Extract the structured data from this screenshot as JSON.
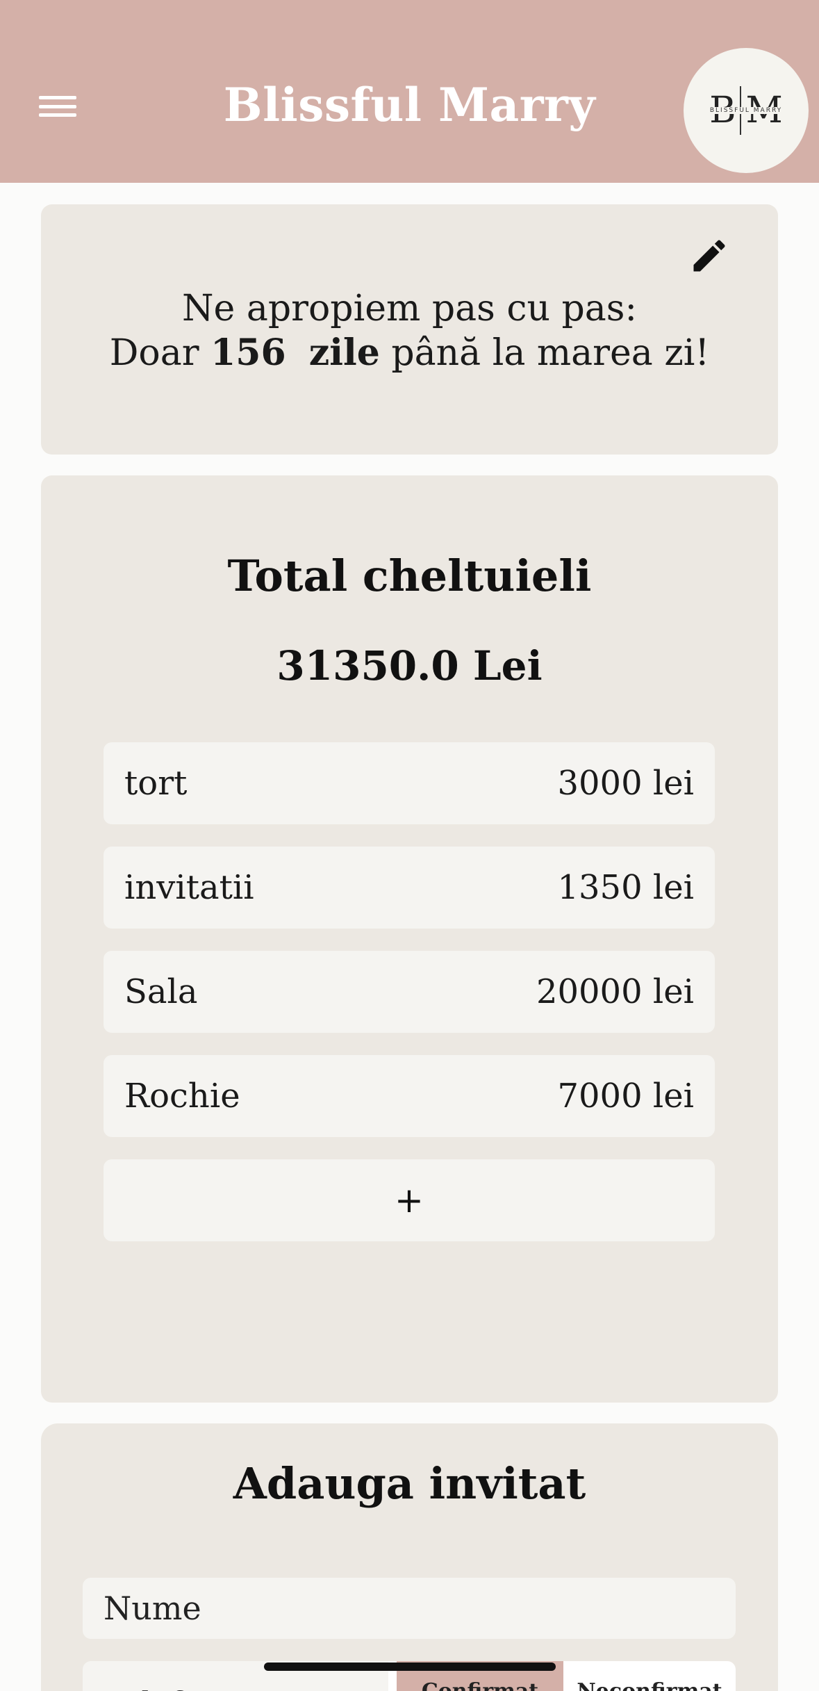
{
  "header": {
    "title": "Blissful Marry",
    "menu_icon": "hamburger-menu-icon",
    "logo": {
      "initials_left": "B",
      "initials_right": "M",
      "brand": "BLISSFUL MARRY"
    },
    "background": "#d4b0a8"
  },
  "countdown": {
    "line1": "Ne apropiem pas cu pas:",
    "prefix": "Doar",
    "days": "156",
    "days_unit": "zile",
    "suffix": "până la marea zi!",
    "edit_icon": "pencil-icon"
  },
  "expenses": {
    "title": "Total cheltuieli",
    "total": "31350.0 Lei",
    "items": [
      {
        "label": "tort",
        "amount": "3000 lei"
      },
      {
        "label": "invitatii",
        "amount": "1350 lei"
      },
      {
        "label": "Sala",
        "amount": "20000 lei"
      },
      {
        "label": "Rochie",
        "amount": "7000 lei"
      }
    ],
    "add_label": "+"
  },
  "guest_form": {
    "title": "Adauga invitat",
    "name_placeholder": "Nume",
    "phone_placeholder": "Telefon",
    "status_options": [
      "Confirmat",
      "Neconfirmat"
    ],
    "selected_status": "Confirmat"
  },
  "colors": {
    "accent": "#d4b0a8",
    "card": "#ece8e2",
    "item": "#f5f4f1"
  }
}
